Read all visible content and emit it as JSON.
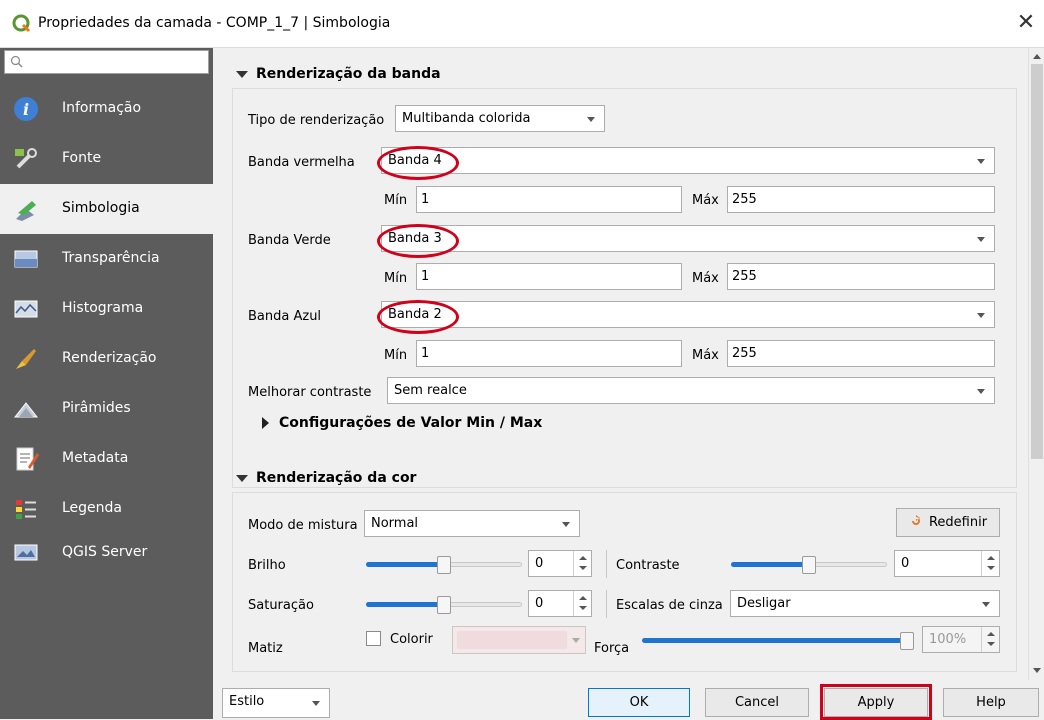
{
  "window": {
    "title": "Propriedades da camada - COMP_1_7 | Simbologia",
    "close_label": "✕"
  },
  "sidebar": {
    "search_placeholder": "",
    "items": [
      {
        "label": "Informação",
        "icon": "info-icon"
      },
      {
        "label": "Fonte",
        "icon": "source-icon"
      },
      {
        "label": "Simbologia",
        "icon": "symbology-icon",
        "selected": true
      },
      {
        "label": "Transparência",
        "icon": "transparency-icon"
      },
      {
        "label": "Histograma",
        "icon": "histogram-icon"
      },
      {
        "label": "Renderização",
        "icon": "rendering-icon"
      },
      {
        "label": "Pirâmides",
        "icon": "pyramids-icon"
      },
      {
        "label": "Metadata",
        "icon": "metadata-icon"
      },
      {
        "label": "Legenda",
        "icon": "legend-icon"
      },
      {
        "label": "QGIS Server",
        "icon": "qgis-server-icon"
      }
    ]
  },
  "band_rendering": {
    "header": "Renderização da banda",
    "render_type_label": "Tipo de renderização",
    "render_type_value": "Multibanda colorida",
    "red_label": "Banda vermelha",
    "red_value": "Banda 4",
    "green_label": "Banda Verde",
    "green_value": "Banda 3",
    "blue_label": "Banda Azul",
    "blue_value": "Banda 2",
    "min_label": "Mín",
    "max_label": "Máx",
    "red_min": "1",
    "red_max": "255",
    "green_min": "1",
    "green_max": "255",
    "blue_min": "1",
    "blue_max": "255",
    "contrast_label": "Melhorar contraste",
    "contrast_value": "Sem realce",
    "minmax_header": "Configurações de Valor Min / Max"
  },
  "color_rendering": {
    "header": "Renderização da cor",
    "blend_label": "Modo de mistura",
    "blend_value": "Normal",
    "reset_label": "Redefinir",
    "brightness_label": "Brilho",
    "brightness_value": "0",
    "brightness_level": 0.5,
    "contrast_label": "Contraste",
    "contrast_value": "0",
    "contrast_level": 0.5,
    "saturation_label": "Saturação",
    "saturation_value": "0",
    "saturation_level": 0.5,
    "grayscale_label": "Escalas de cinza",
    "grayscale_value": "Desligar",
    "hue_label": "Matiz",
    "colorize_label": "Colorir",
    "strength_label": "Força",
    "strength_value": "100%",
    "strength_level": 1.0
  },
  "footer": {
    "style_label": "Estilo",
    "ok_label": "OK",
    "cancel_label": "Cancel",
    "apply_label": "Apply",
    "help_label": "Help"
  },
  "colors": {
    "sidebar_bg": "#5c5c5c",
    "accent": "#1e74d0",
    "annotation": "#d0021b"
  }
}
